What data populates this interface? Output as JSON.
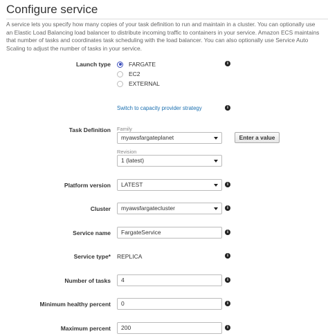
{
  "header": {
    "title": "Configure service",
    "description": "A service lets you specify how many copies of your task definition to run and maintain in a cluster. You can optionally use an Elastic Load Balancing load balancer to distribute incoming traffic to containers in your service. Amazon ECS maintains that number of tasks and coordinates task scheduling with the load balancer. You can also optionally use Service Auto Scaling to adjust the number of tasks in your service."
  },
  "launch_type": {
    "label": "Launch type",
    "options": [
      "FARGATE",
      "EC2",
      "EXTERNAL"
    ],
    "selected": "FARGATE",
    "capacity_link": "Switch to capacity provider strategy"
  },
  "task_definition": {
    "label": "Task Definition",
    "family_label": "Family",
    "family_value": "myawsfargateplanet",
    "revision_label": "Revision",
    "revision_value": "1 (latest)",
    "enter_value_button": "Enter a value"
  },
  "platform_version": {
    "label": "Platform version",
    "value": "LATEST"
  },
  "cluster": {
    "label": "Cluster",
    "value": "myawsfargatecluster"
  },
  "service_name": {
    "label": "Service name",
    "value": "FargateService"
  },
  "service_type": {
    "label": "Service type*",
    "value": "REPLICA"
  },
  "number_of_tasks": {
    "label": "Number of tasks",
    "value": "4"
  },
  "min_healthy": {
    "label": "Minimum healthy percent",
    "value": "0"
  },
  "max_percent": {
    "label": "Maximum percent",
    "value": "200"
  },
  "icons": {
    "info": "i"
  }
}
